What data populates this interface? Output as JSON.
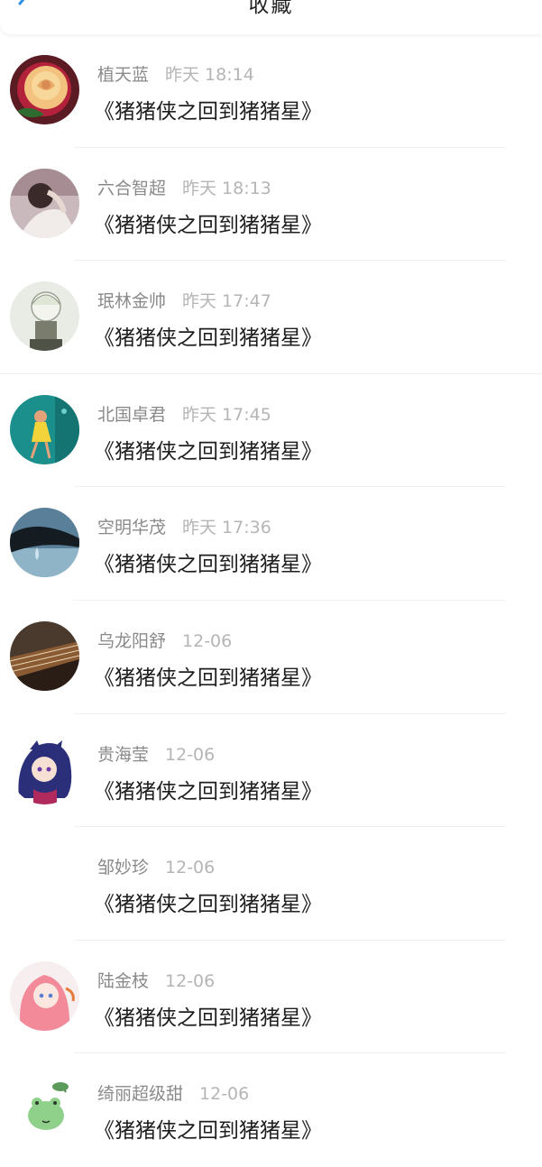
{
  "header": {
    "title": "收藏",
    "back_icon": "chevron-left-icon",
    "accent": "#2f8fe8"
  },
  "items": [
    {
      "name": "植天蓝",
      "time": "昨天 18:14",
      "message": "《猪猪侠之回到猪猪星》",
      "avatar": "rose-avatar"
    },
    {
      "name": "六合智超",
      "time": "昨天 18:13",
      "message": "《猪猪侠之回到猪猪星》",
      "avatar": "girl-photo-avatar"
    },
    {
      "name": "珉林金帅",
      "time": "昨天 17:47",
      "message": "《猪猪侠之回到猪猪星》",
      "avatar": "anime-boy-avatar"
    },
    {
      "name": "北国卓君",
      "time": "昨天 17:45",
      "message": "《猪猪侠之回到猪猪星》",
      "avatar": "teal-illustration-avatar"
    },
    {
      "name": "空明华茂",
      "time": "昨天 17:36",
      "message": "《猪猪侠之回到猪猪星》",
      "avatar": "water-drop-avatar"
    },
    {
      "name": "乌龙阳舒",
      "time": "12-06",
      "message": "《猪猪侠之回到猪猪星》",
      "avatar": "guzheng-avatar"
    },
    {
      "name": "贵海莹",
      "time": "12-06",
      "message": "《猪猪侠之回到猪猪星》",
      "avatar": "anime-girl-blue-avatar"
    },
    {
      "name": "邹妙珍",
      "time": "12-06",
      "message": "《猪猪侠之回到猪猪星》",
      "avatar": ""
    },
    {
      "name": "陆金枝",
      "time": "12-06",
      "message": "《猪猪侠之回到猪猪星》",
      "avatar": "anime-girl-pink-avatar"
    },
    {
      "name": "绮丽超级甜",
      "time": "12-06",
      "message": "《猪猪侠之回到猪猪星》",
      "avatar": "frog-avatar"
    }
  ]
}
